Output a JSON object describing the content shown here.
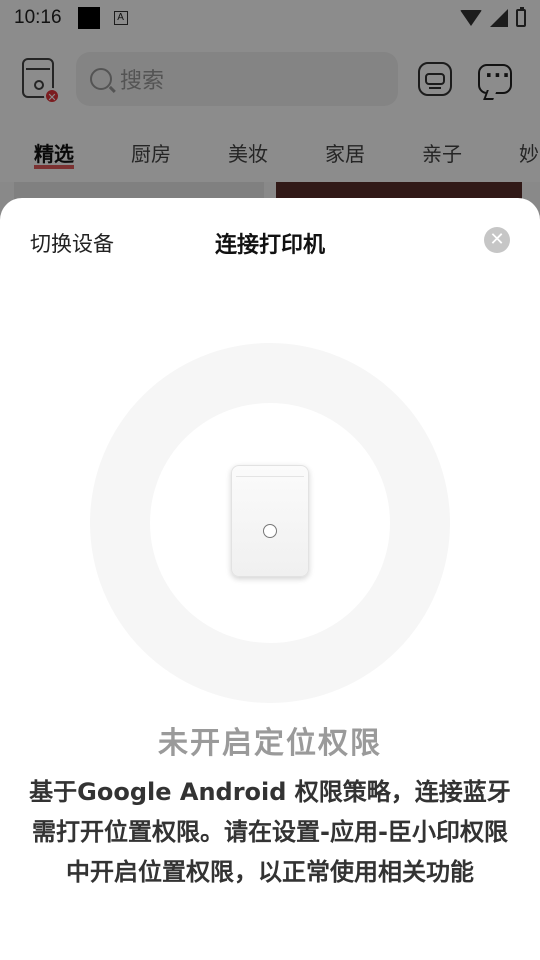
{
  "status_bar": {
    "time": "10:16",
    "app_badge": "A"
  },
  "header": {
    "search_placeholder": "搜索",
    "device_error_badge": "✕"
  },
  "tabs": [
    "精选",
    "厨房",
    "美妆",
    "家居",
    "亲子",
    "妙"
  ],
  "sheet": {
    "switch_device": "切换设备",
    "title": "连接打印机",
    "close_symbol": "✕",
    "permission_title": "未开启定位权限",
    "permission_body": "基于Google Android 权限策略，连接蓝牙需打开位置权限。请在设置-应用-臣小印权限中开启位置权限，以正常使用相关功能"
  },
  "colors": {
    "active_tab_underline": "#e05a5a",
    "error_badge": "#e0353b",
    "overlay": "rgba(0,0,0,0.45)"
  }
}
